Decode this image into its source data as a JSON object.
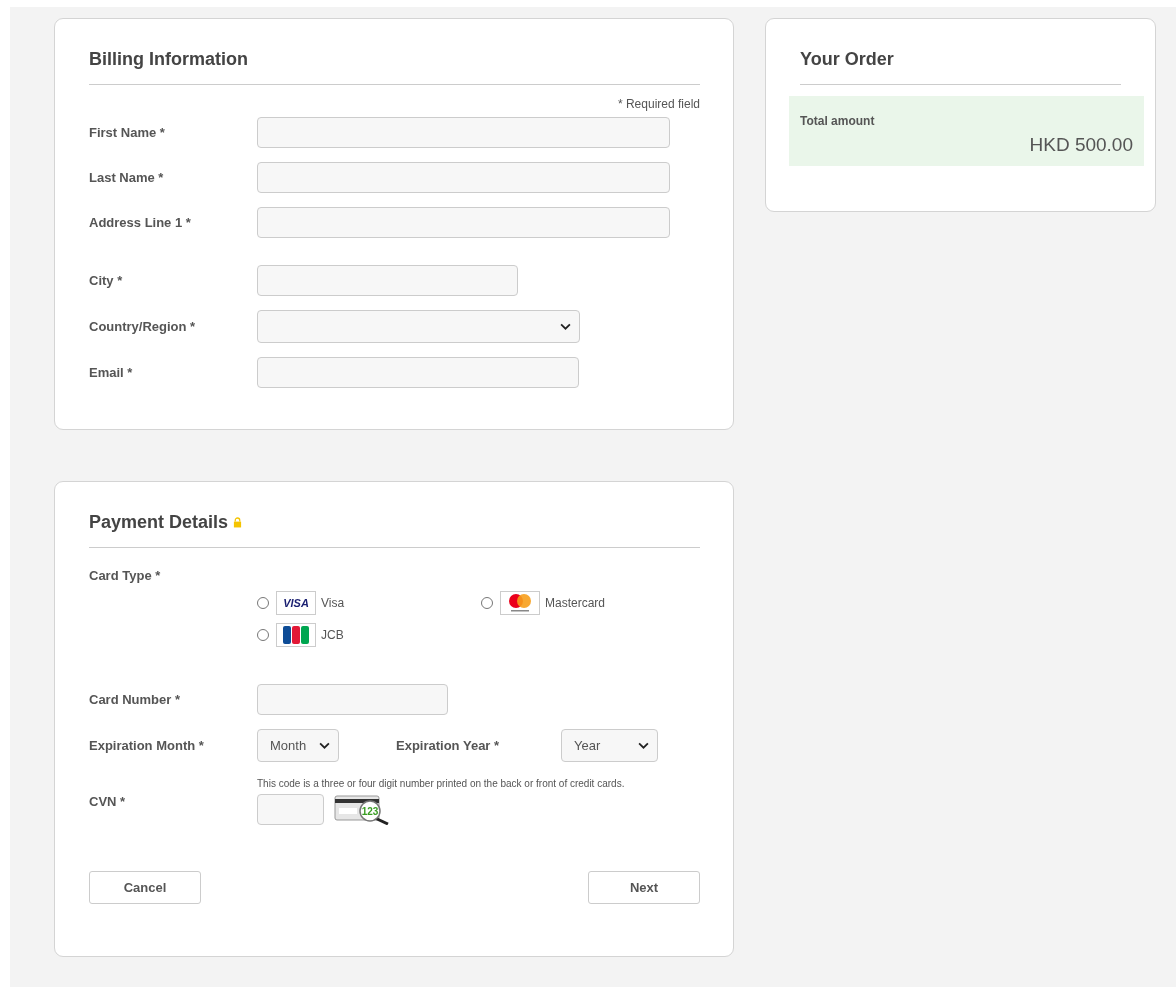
{
  "billing": {
    "title": "Billing Information",
    "required_note": "* Required field",
    "fields": [
      {
        "label": "First Name *",
        "kind": "input"
      },
      {
        "label": "Last Name *",
        "kind": "input"
      },
      {
        "label": "Address Line 1 *",
        "kind": "input"
      },
      {
        "label": "City *",
        "kind": "input"
      },
      {
        "label": "Country/Region *",
        "kind": "select"
      },
      {
        "label": "Email *",
        "kind": "input"
      }
    ]
  },
  "order": {
    "title": "Your Order",
    "total_label": "Total amount",
    "total": "HKD 500.00"
  },
  "payment": {
    "title": "Payment Details",
    "card_type_label": "Card Type *",
    "cards": [
      {
        "name": "Visa",
        "kind": "visa",
        "logo": "VISA",
        "selected": false
      },
      {
        "name": "Mastercard",
        "kind": "mastercard",
        "selected": false
      },
      {
        "name": "JCB",
        "kind": "jcb",
        "selected": false
      }
    ],
    "card_number_label": "Card Number *",
    "month_label": "Expiration Month *",
    "month_value": "Month",
    "year_label": "Expiration Year *",
    "year_value": "Year",
    "cvn_label": "CVN *",
    "cvn_hint": "This code is a three or four digit number printed on the back or front of credit cards.",
    "cvn_icon_digits": "123",
    "buttons": [
      {
        "label": "Cancel"
      },
      {
        "label": "Next"
      }
    ]
  }
}
